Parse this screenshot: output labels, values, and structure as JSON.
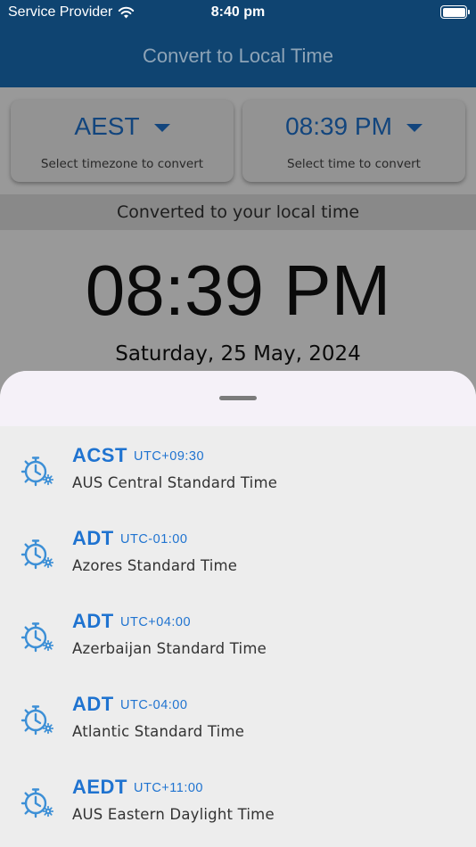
{
  "status_bar": {
    "carrier": "Service Provider",
    "time": "8:40 pm"
  },
  "header": {
    "title": "Convert to Local Time"
  },
  "pickers": {
    "timezone": {
      "value": "AEST",
      "hint": "Select timezone to convert"
    },
    "time": {
      "value": "08:39 PM",
      "hint": "Select time to convert"
    }
  },
  "converted": {
    "banner": "Converted to your local time",
    "time": "08:39 PM",
    "date": "Saturday, 25 May, 2024"
  },
  "timezone_list": [
    {
      "abbr": "ACST",
      "offset": "UTC+09:30",
      "name": "AUS Central Standard Time"
    },
    {
      "abbr": "ADT",
      "offset": "UTC-01:00",
      "name": "Azores Standard Time"
    },
    {
      "abbr": "ADT",
      "offset": "UTC+04:00",
      "name": "Azerbaijan Standard Time"
    },
    {
      "abbr": "ADT",
      "offset": "UTC-04:00",
      "name": "Atlantic Standard Time"
    },
    {
      "abbr": "AEDT",
      "offset": "UTC+11:00",
      "name": "AUS Eastern Daylight Time"
    }
  ],
  "colors": {
    "header_bg": "#0f4471",
    "accent_blue": "#1f73d0",
    "icon_blue": "#3c8fd6"
  },
  "icons": {
    "timezone_item": "clock-gear-icon",
    "wifi": "wifi-icon",
    "battery": "battery-icon"
  }
}
